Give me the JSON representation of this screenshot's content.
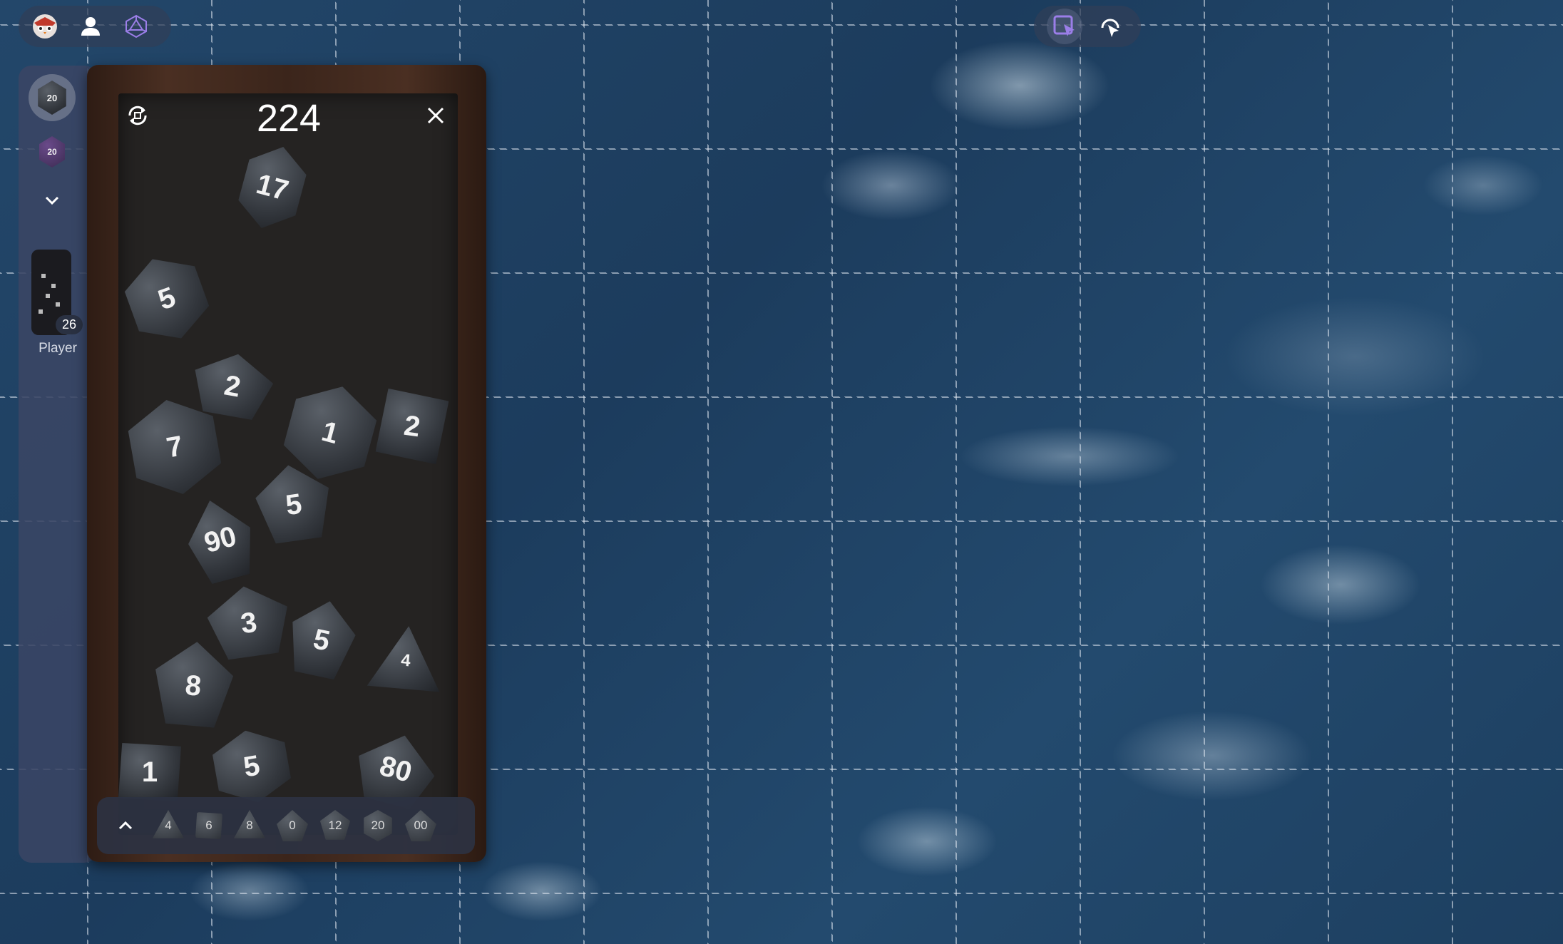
{
  "dice_tray": {
    "total": "224",
    "dice": [
      "17",
      "5",
      "2",
      "7",
      "1",
      "2",
      "5",
      "90",
      "3",
      "5",
      "8",
      "4",
      "1",
      "5",
      "80"
    ]
  },
  "player": {
    "label": "Player",
    "count": "26"
  },
  "picker": {
    "dice": [
      "4",
      "6",
      "8",
      "0",
      "12",
      "20",
      "00"
    ]
  },
  "colors": {
    "accent": "#9b7ee8",
    "background": "#1e3f60"
  },
  "icons": {
    "topbar": [
      "owlbear-logo-icon",
      "person-icon",
      "d20-icon"
    ],
    "topright": [
      "pointer-select-icon",
      "pointer-broadcast-icon"
    ]
  }
}
